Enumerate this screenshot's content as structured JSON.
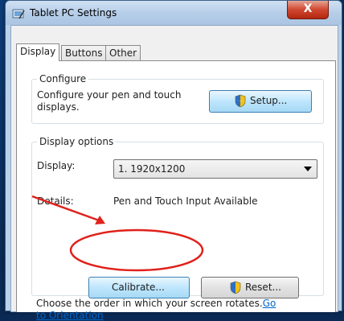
{
  "window": {
    "title": "Tablet PC Settings"
  },
  "close_button": {
    "label": "X"
  },
  "tabs": [
    {
      "label": "Display",
      "active": true
    },
    {
      "label": "Buttons",
      "active": false
    },
    {
      "label": "Other",
      "active": false
    }
  ],
  "configure": {
    "group_title": "Configure",
    "description_line1": "Configure your pen and touch",
    "description_line2": "displays.",
    "setup_label": "Setup..."
  },
  "display_options": {
    "group_title": "Display options",
    "display_label": "Display:",
    "display_value": "1. 1920x1200",
    "details_label": "Details:",
    "details_value": "Pen and Touch Input Available",
    "calibrate_label": "Calibrate...",
    "reset_label": "Reset..."
  },
  "orientation": {
    "line1_text": "Choose the order in which your screen rotates.",
    "link_part1": "Go",
    "link_part2": "to Orientation"
  },
  "colors": {
    "annotation": "#e0211b",
    "link": "#0066cc",
    "close": "#d0472f"
  }
}
